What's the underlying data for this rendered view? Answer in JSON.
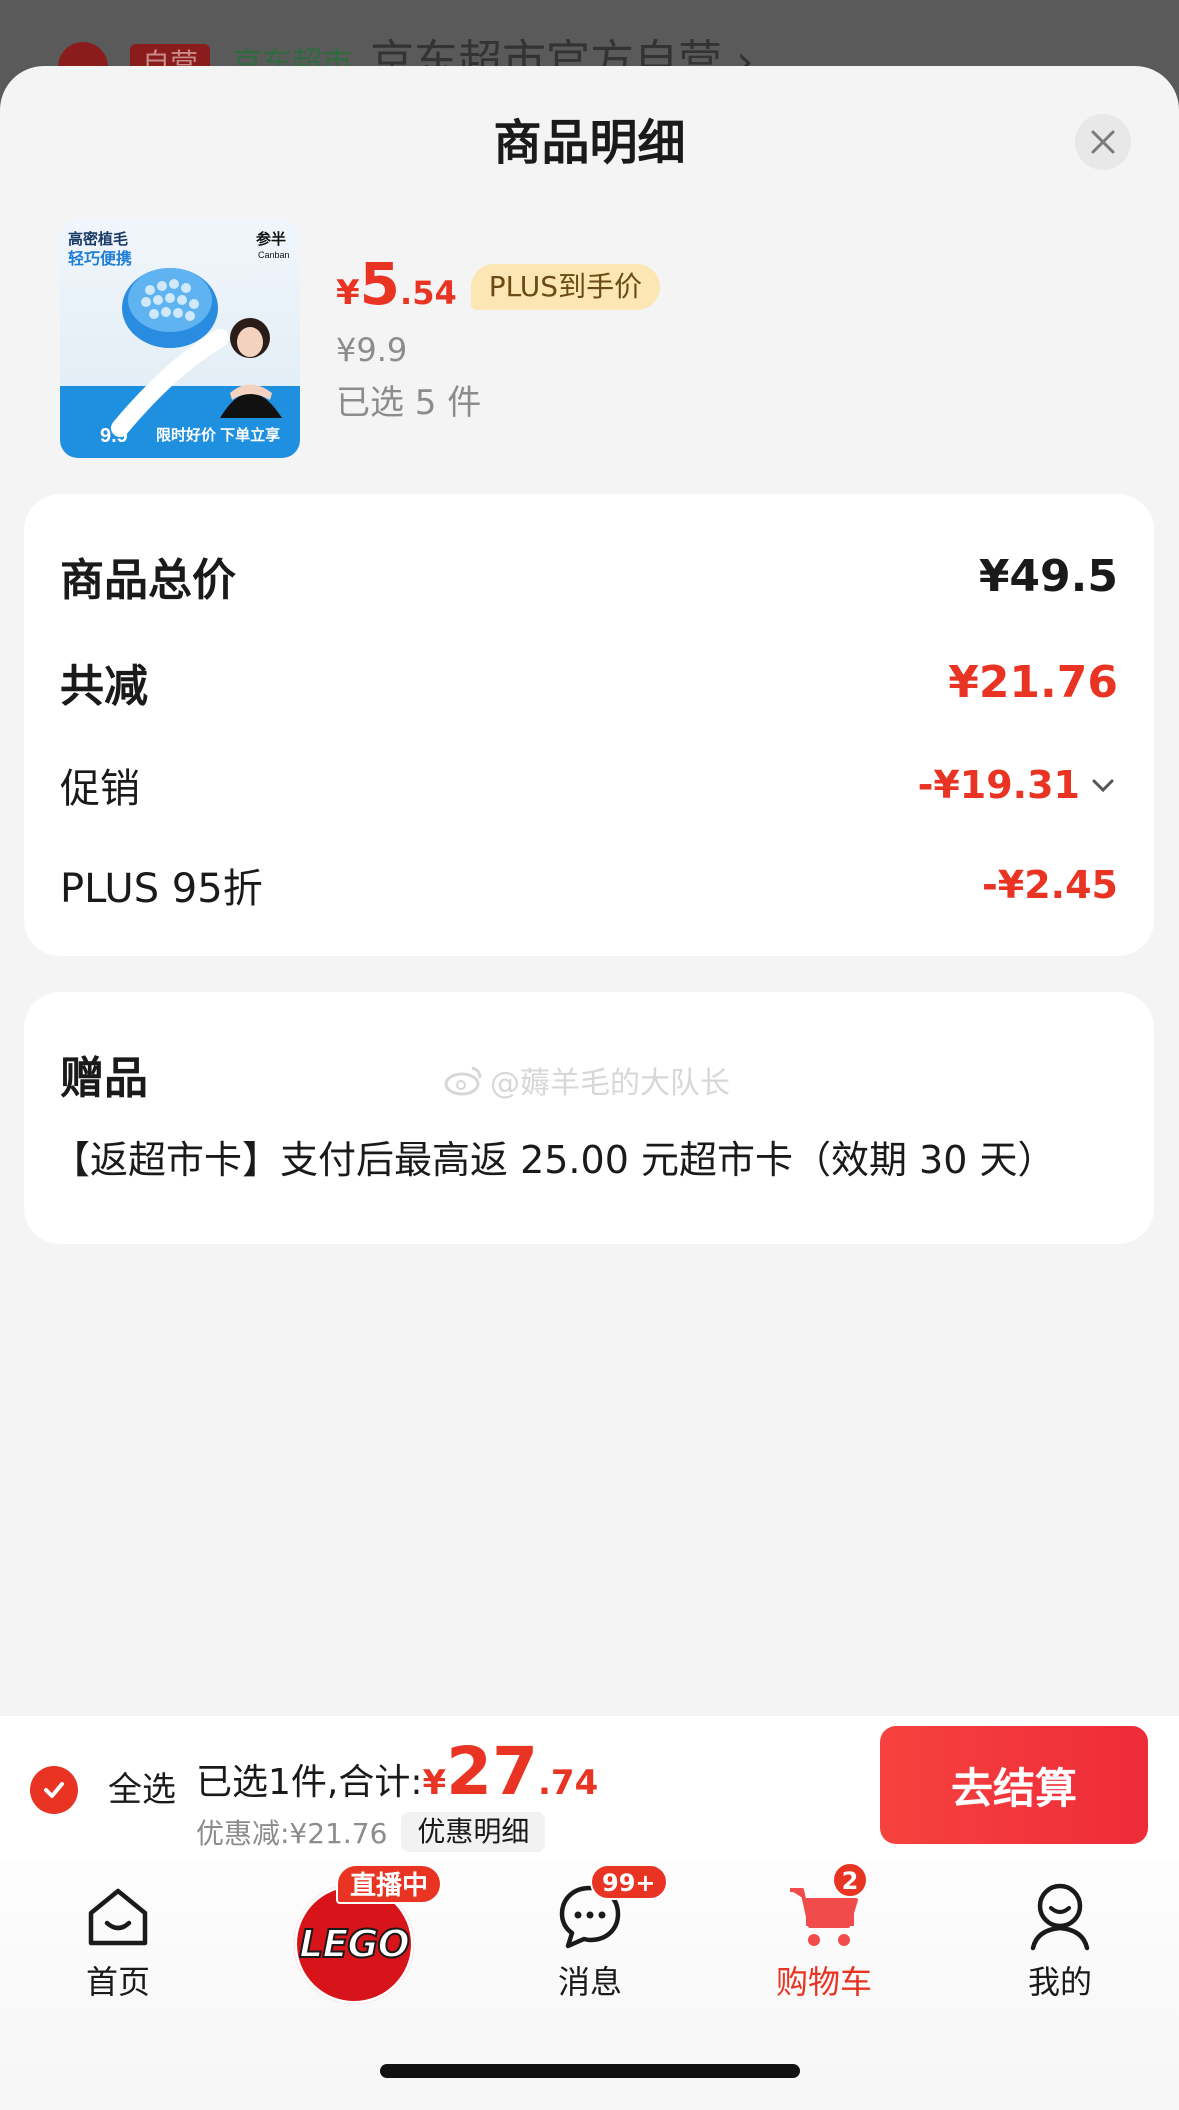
{
  "behind": {
    "tag": "自营",
    "store_label": "京东超市",
    "title": "京东超市官方自营 ›"
  },
  "sheet": {
    "title": "商品明细"
  },
  "product": {
    "thumb_text_1": "高密植毛",
    "thumb_text_2": "轻巧便携",
    "thumb_brand": "参半",
    "thumb_brand_en": "Canban",
    "thumb_price": "9.9",
    "thumb_promo": "限时好价 下单立享",
    "price_symbol": "¥",
    "price_int": "5",
    "price_dec": ".54",
    "plus_badge": "PLUS到手价",
    "original_price": "¥9.9",
    "selected": "已选 5 件"
  },
  "summary": {
    "total_label": "商品总价",
    "total_value": "¥49.5",
    "reduce_label": "共减",
    "reduce_value": "¥21.76",
    "promo_label": "促销",
    "promo_value": "-¥19.31",
    "plus_label": "PLUS 95折",
    "plus_value": "-¥2.45"
  },
  "gift": {
    "title": "赠品",
    "text": "【返超市卡】支付后最高返 25.00 元超市卡（效期 30 天）",
    "watermark": "@薅羊毛的大队长"
  },
  "checkout": {
    "select_all": "全选",
    "total_label": "已选1件,合计:",
    "total_symbol": "¥",
    "total_int": "27",
    "total_dec": ".74",
    "discount_text": "优惠减:¥21.76",
    "detail_chip": "优惠明细",
    "button": "去结算"
  },
  "tabbar": {
    "home": "首页",
    "live_badge": "直播中",
    "lego": "LEGO",
    "messages": "消息",
    "messages_badge": "99+",
    "cart": "购物车",
    "cart_badge": "2",
    "me": "我的"
  },
  "colors": {
    "accent_red": "#e93323",
    "plus_gold": "#fbe6b4"
  }
}
